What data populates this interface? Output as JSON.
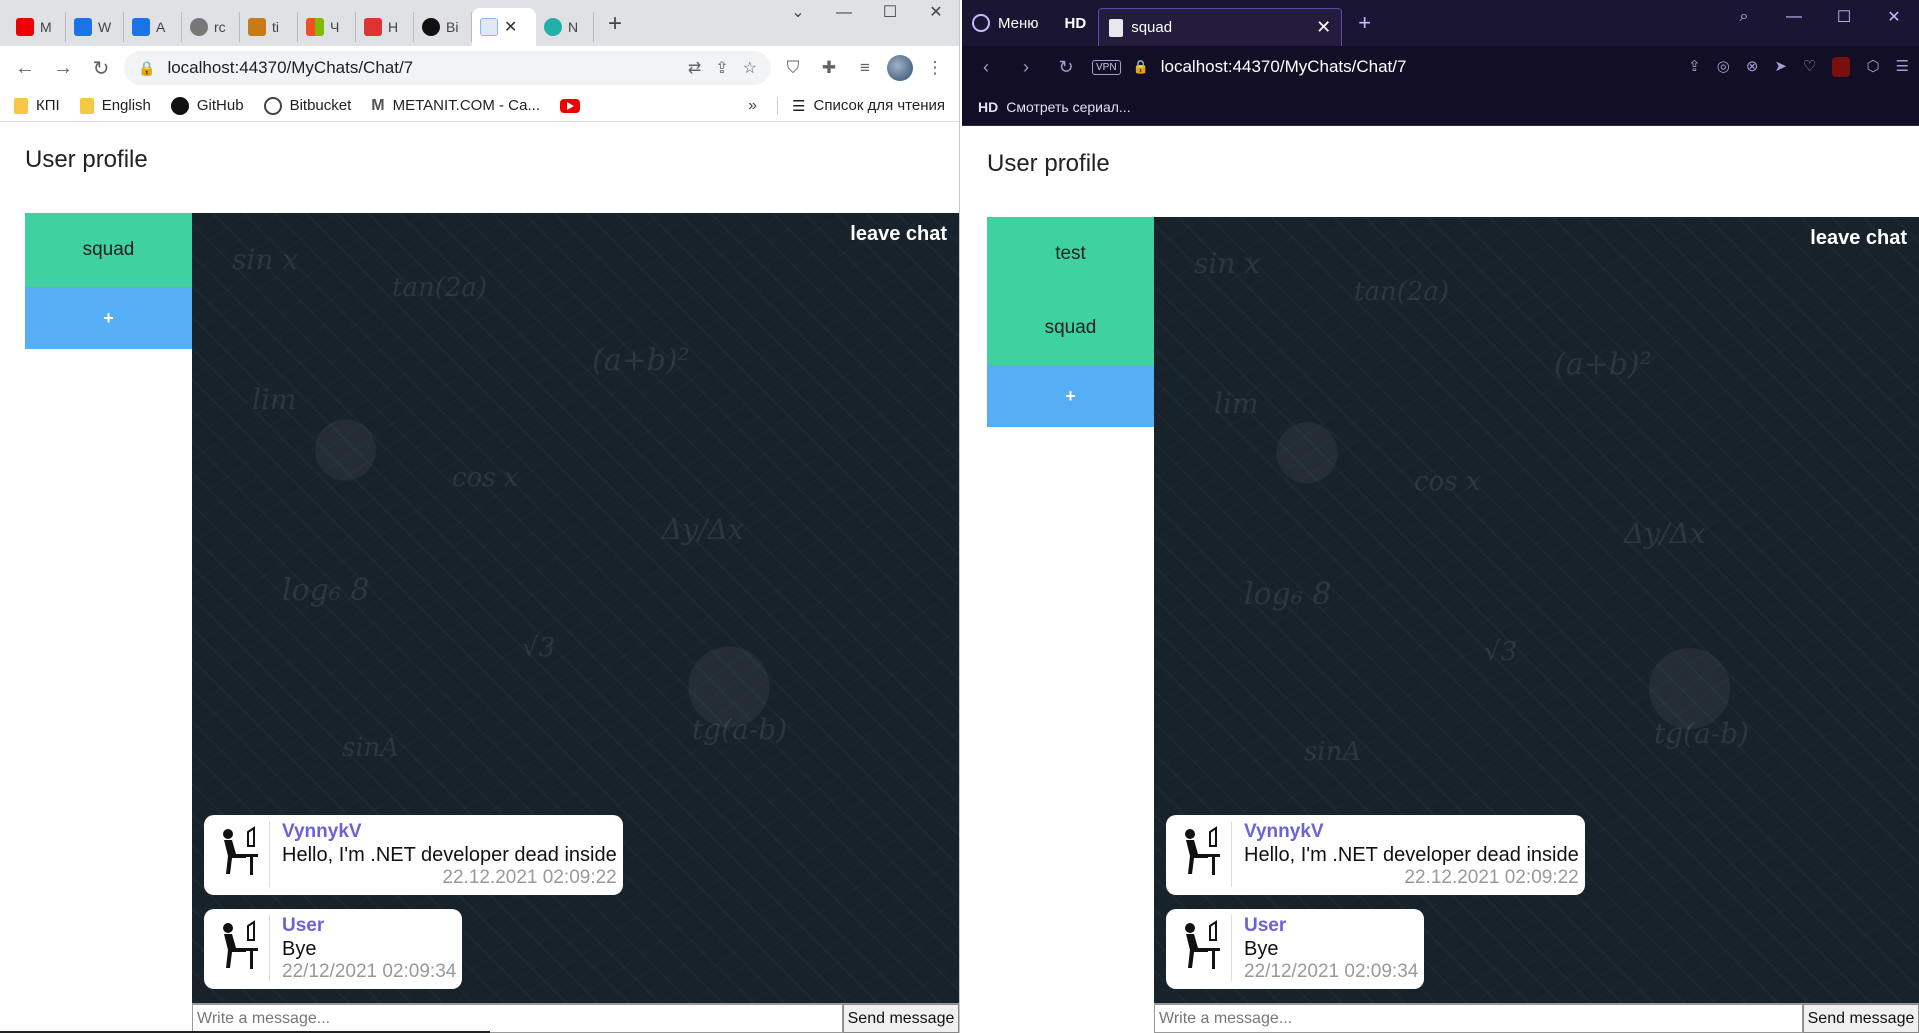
{
  "chrome": {
    "tabs": [
      {
        "title": "M",
        "color": "#e00"
      },
      {
        "title": "W",
        "color": "#1a73e8"
      },
      {
        "title": "A",
        "color": "#1a73e8"
      },
      {
        "title": "rc",
        "color": "#555"
      },
      {
        "title": "ti",
        "color": "#c77a15"
      },
      {
        "title": "Ч",
        "color": "#f25022"
      },
      {
        "title": "Н",
        "color": "#d33"
      },
      {
        "title": "Bi",
        "color": "#111"
      },
      {
        "title": "",
        "color": "#8ab4f8"
      },
      {
        "title": "N",
        "color": "#20b2aa"
      }
    ],
    "url": "localhost:44370/MyChats/Chat/7",
    "bookmarks": [
      "КПІ",
      "English",
      "GitHub",
      "Bitbucket",
      "METANIT.COM - Са..."
    ],
    "bookmarks_more": "»",
    "reading_list": "Список для чтения"
  },
  "opera": {
    "menu_label": "Меню",
    "hd_label": "HD",
    "tab_title": "squad",
    "vpn_label": "VPN",
    "url": "localhost:44370/MyChats/Chat/7",
    "bookmark_hd": "HD",
    "bookmark_label": "Смотреть сериал..."
  },
  "left_page": {
    "title": "User profile",
    "chats": [
      "squad"
    ],
    "add_label": "+",
    "leave_label": "leave chat",
    "messages": [
      {
        "author": "VynnykV",
        "text": "Hello, I'm .NET developer dead inside",
        "time": "22.12.2021 02:09:22"
      },
      {
        "author": "User",
        "text": "Bye",
        "time": "22/12/2021 02:09:34"
      }
    ],
    "input_placeholder": "Write a message...",
    "send_label": "Send message"
  },
  "right_page": {
    "title": "User profile",
    "chats": [
      "test",
      "squad"
    ],
    "add_label": "+",
    "leave_label": "leave chat",
    "messages": [
      {
        "author": "VynnykV",
        "text": "Hello, I'm .NET developer dead inside",
        "time": "22.12.2021 02:09:22"
      },
      {
        "author": "User",
        "text": "Bye",
        "time": "22/12/2021 02:09:34"
      }
    ],
    "input_placeholder": "Write a message...",
    "send_label": "Send message"
  }
}
